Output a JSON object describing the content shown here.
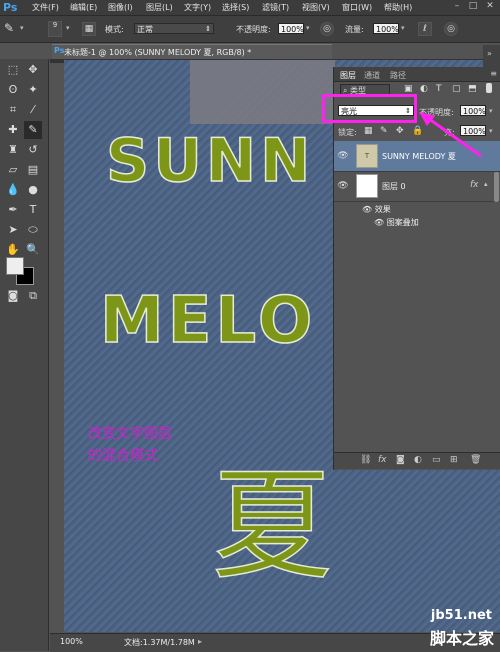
{
  "menubar": {
    "logo": "Ps",
    "items": [
      "文件(F)",
      "编辑(E)",
      "图像(I)",
      "图层(L)",
      "文字(Y)",
      "选择(S)",
      "滤镜(T)",
      "视图(V)",
      "窗口(W)",
      "帮助(H)"
    ]
  },
  "options": {
    "brush_size": "9",
    "mode_label": "模式:",
    "mode_value": "正常",
    "opacity_label": "不透明度:",
    "opacity_value": "100%",
    "flow_label": "流量:",
    "flow_value": "100%"
  },
  "document": {
    "tab_title": "未标题-1 @ 100% (SUNNY MELODY 夏, RGB/8) *",
    "text_line1": "SUNN",
    "text_line2": "MELO",
    "text_char": "夏",
    "zoom": "100%",
    "doc_info": "文档:1.37M/1.78M"
  },
  "layers_panel": {
    "tabs": [
      "图层",
      "通道",
      "路径"
    ],
    "filter_value": "类型",
    "blend_mode": "亮光",
    "opacity_label": "不透明度:",
    "opacity_value": "100%",
    "lock_label": "锁定:",
    "fill_label": "充:",
    "fill_value": "100%",
    "layers": [
      {
        "name": "SUNNY MELODY 夏"
      },
      {
        "name": "图层 0",
        "fx": "fx"
      }
    ],
    "effects_label": "效果",
    "effect_item": "图案叠加"
  },
  "annotation": {
    "line1": "改变文字图层",
    "line2": "的混合模式"
  },
  "watermark": {
    "line1": "jb51.net",
    "line2": "脚本之家"
  }
}
